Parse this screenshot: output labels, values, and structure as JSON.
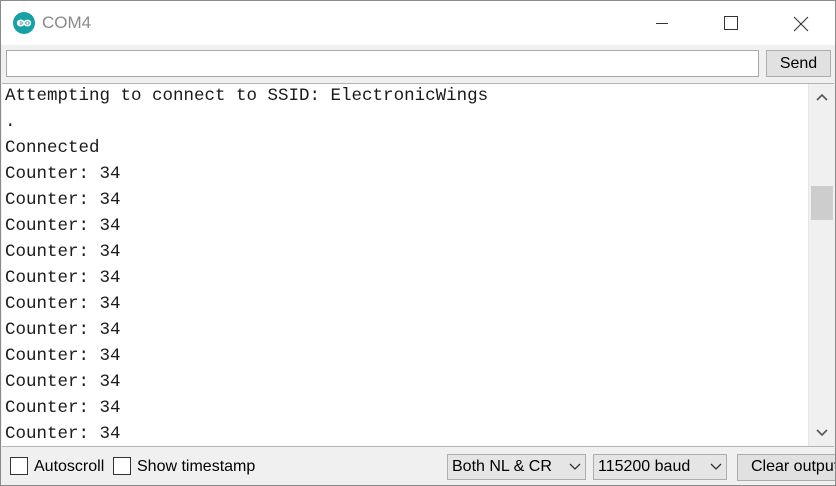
{
  "window": {
    "title": "COM4",
    "app_icon": "arduino-infinity-icon",
    "controls": [
      "minimize-icon",
      "maximize-icon",
      "close-icon"
    ]
  },
  "send_row": {
    "input_value": "",
    "send_label": "Send"
  },
  "console": {
    "lines": [
      "Attempting to connect to SSID: ElectronicWings",
      ".",
      "Connected",
      "Counter: 34",
      "Counter: 34",
      "Counter: 34",
      "Counter: 34",
      "Counter: 34",
      "Counter: 34",
      "Counter: 34",
      "Counter: 34",
      "Counter: 34",
      "Counter: 34",
      "Counter: 34"
    ],
    "scroll_position": 0.31
  },
  "bottom_bar": {
    "autoscroll_label": "Autoscroll",
    "autoscroll_checked": false,
    "timestamp_label": "Show timestamp",
    "timestamp_checked": false,
    "line_ending_selected": "Both NL & CR",
    "baud_selected": "115200 baud",
    "clear_label": "Clear output"
  },
  "colors": {
    "logo": "#17a1a5",
    "title_text": "#8a8a8a",
    "console_bg": "#ffffff",
    "chrome_bg": "#f0f0f0"
  }
}
